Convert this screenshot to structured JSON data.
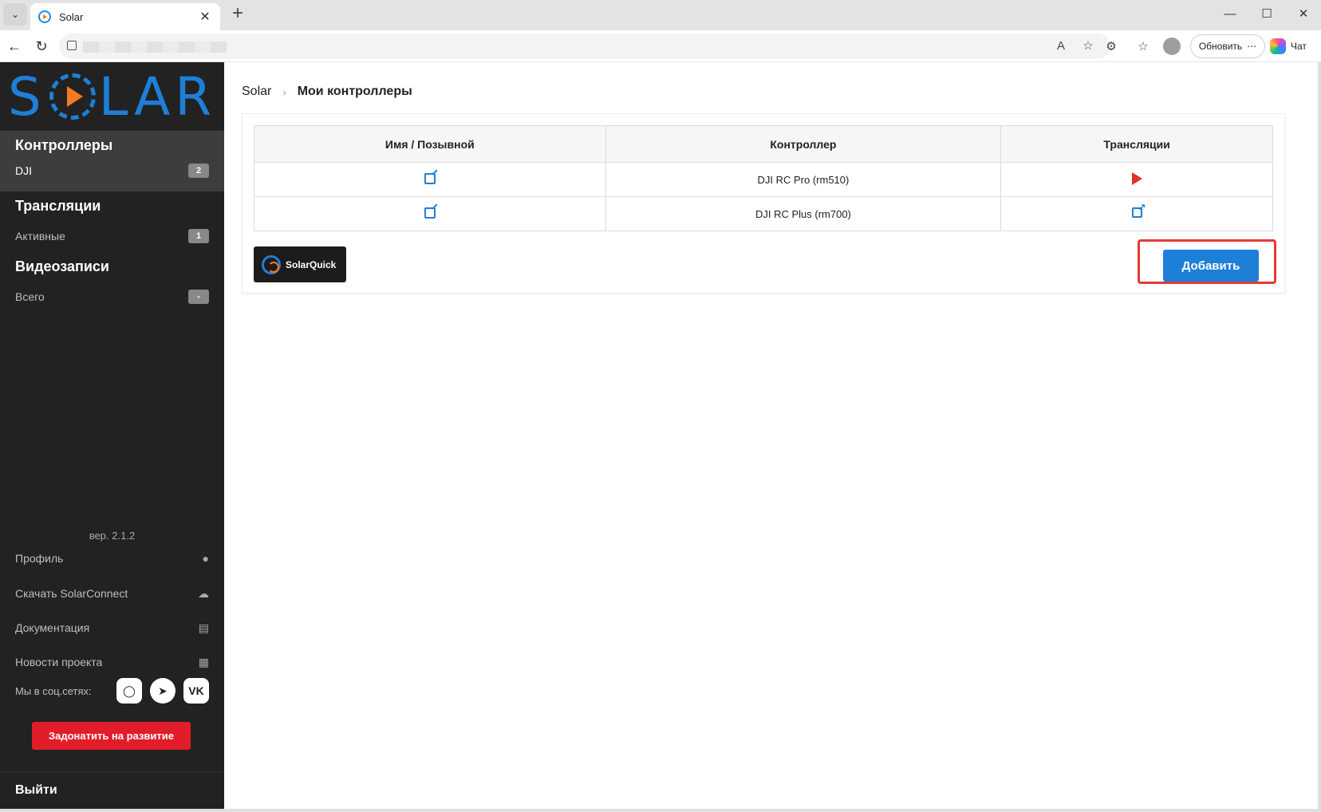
{
  "browser": {
    "tab_title": "Solar",
    "update_label": "Обновить",
    "chat_label": "Чат"
  },
  "sidebar": {
    "logo_text_left": "S",
    "logo_text_right": "LAR",
    "sections": [
      {
        "title": "Контроллеры",
        "items": [
          {
            "label": "DJI",
            "badge": "2"
          }
        ]
      },
      {
        "title": "Трансляции",
        "items": [
          {
            "label": "Активные",
            "badge": "1"
          }
        ]
      },
      {
        "title": "Видеозаписи",
        "items": [
          {
            "label": "Всего",
            "badge": "-"
          }
        ]
      }
    ],
    "version": "вер. 2.1.2",
    "links": {
      "profile": "Профиль",
      "download": "Скачать SolarConnect",
      "docs": "Документация",
      "news": "Новости проекта"
    },
    "social_label": "Мы в соц.сетях:",
    "donate_label": "Задонатить на развитие",
    "logout_label": "Выйти"
  },
  "breadcrumb": {
    "root": "Solar",
    "current": "Мои контроллеры"
  },
  "table": {
    "headers": [
      "Имя / Позывной",
      "Контроллер",
      "Трансляции"
    ],
    "rows": [
      {
        "controller": "DJI RC Pro (rm510)",
        "stream_icon": "play-icon"
      },
      {
        "controller": "DJI RC Plus (rm700)",
        "stream_icon": "external-link-icon"
      }
    ]
  },
  "solarquick_label": "SolarQuick",
  "add_button_label": "Добавить",
  "colors": {
    "accent": "#1e7fd8",
    "brand_orange": "#f47b20",
    "danger": "#e11d2a",
    "sidebar_bg": "#222222"
  }
}
